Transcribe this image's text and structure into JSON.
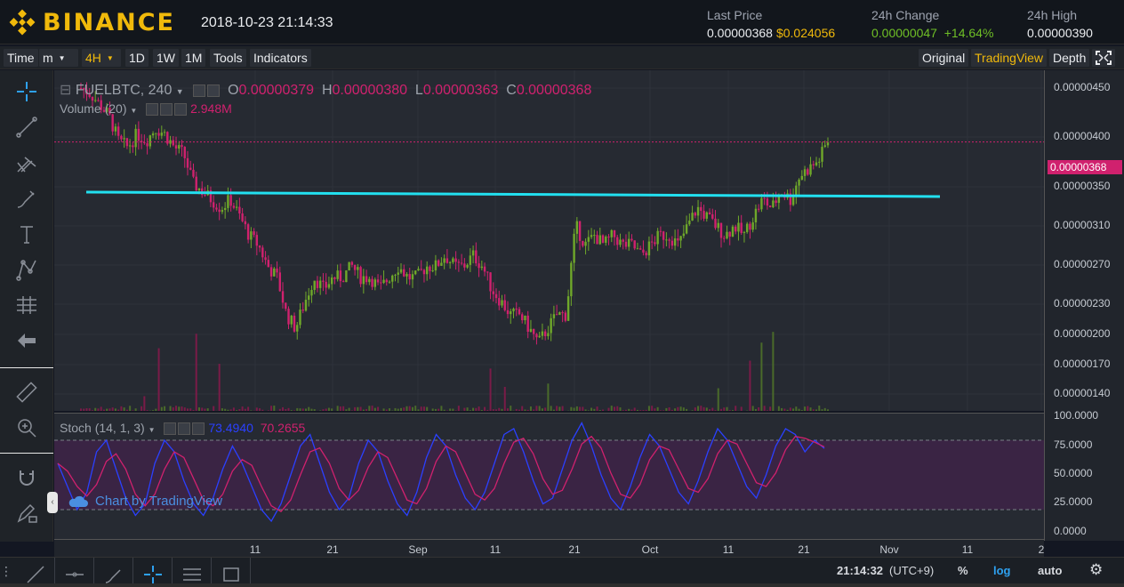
{
  "header": {
    "brand": "BINANCE",
    "datetime": "2018-10-23 21:14:33",
    "last_price_label": "Last Price",
    "last_price_btc": "0.00000368",
    "last_price_usd": "$0.024056",
    "change_label": "24h Change",
    "change_value": "0.00000047",
    "change_pct": "+14.64%",
    "high_label": "24h High",
    "high_value": "0.00000390"
  },
  "toolbar": {
    "time": "Time",
    "minute": "m",
    "interval": "4H",
    "d1": "1D",
    "w1": "1W",
    "m1": "1M",
    "tools": "Tools",
    "indicators": "Indicators",
    "original": "Original",
    "tradingview": "TradingView",
    "depth": "Depth"
  },
  "legend": {
    "symbol": "FUELBTC, 240",
    "o_label": "O",
    "o_value": "0.00000379",
    "h_label": "H",
    "h_value": "0.00000380",
    "l_label": "L",
    "l_value": "0.00000363",
    "c_label": "C",
    "c_value": "0.00000368",
    "volume": "Volume (20)",
    "volume_value": "2.948M",
    "stoch": "Stoch (14, 1, 3)",
    "stoch_k": "73.4940",
    "stoch_d": "70.2655",
    "watermark": "Chart by TradingView"
  },
  "price_axis": {
    "labels": [
      "0.00000450",
      "0.00000400",
      "0.00000350",
      "0.00000310",
      "0.00000270",
      "0.00000230",
      "0.00000200",
      "0.00000170",
      "0.00000140"
    ],
    "current": "0.00000368"
  },
  "stoch_axis": {
    "labels": [
      "100.0000",
      "75.0000",
      "50.0000",
      "25.0000",
      "0.0000"
    ]
  },
  "time_axis": {
    "labels": [
      "11",
      "21",
      "Sep",
      "11",
      "21",
      "Oct",
      "11",
      "21",
      "Nov",
      "11",
      "2"
    ]
  },
  "bottom": {
    "clock": "21:14:32",
    "tz": "(UTC+9)",
    "percent": "%",
    "log": "log",
    "auto": "auto"
  },
  "colors": {
    "accent": "#f0b90b",
    "up": "#6fa82a",
    "down": "#d0216e",
    "support_line": "#22e0f0",
    "stoch_k": "#2b40ff",
    "stoch_d": "#d0216e"
  },
  "chart_data": {
    "type": "candlestick",
    "ylim": [
      1.3e-06,
      4.6e-06
    ],
    "y_scale": "log",
    "close_series": [
      4.6e-06,
      4.5e-06,
      4.3e-06,
      4.1e-06,
      3.7e-06,
      3.6e-06,
      3.8e-06,
      3.7e-06,
      3.9e-06,
      3.8e-06,
      3.6e-06,
      3.5e-06,
      3.1e-06,
      3e-06,
      2.9e-06,
      2.8e-06,
      2.9e-06,
      2.7e-06,
      2.5e-06,
      2.4e-06,
      2.2e-06,
      2.1e-06,
      1.8e-06,
      1.7e-06,
      1.9e-06,
      2.1e-06,
      2e-06,
      2.1e-06,
      2.1e-06,
      2.2e-06,
      2.1e-06,
      2.1e-06,
      2e-06,
      2.1e-06,
      2.2e-06,
      2.1e-06,
      2.1e-06,
      2.2e-06,
      2.2e-06,
      2.3e-06,
      2.2e-06,
      2.2e-06,
      2.3e-06,
      2.2e-06,
      2e-06,
      1.9e-06,
      1.8e-06,
      1.8e-06,
      1.7e-06,
      1.6e-06,
      1.7e-06,
      1.8e-06,
      1.8e-06,
      2.6e-06,
      2.4e-06,
      2.5e-06,
      2.4e-06,
      2.5e-06,
      2.4e-06,
      2.4e-06,
      2.3e-06,
      2.4e-06,
      2.5e-06,
      2.5e-06,
      2.4e-06,
      2.6e-06,
      2.8e-06,
      2.7e-06,
      2.6e-06,
      2.5e-06,
      2.6e-06,
      2.5e-06,
      2.7e-06,
      2.9e-06,
      2.8e-06,
      3e-06,
      2.9e-06,
      3.2e-06,
      3.3e-06,
      3.4e-06,
      3.7e-06
    ],
    "support_level": 3.35e-06,
    "stoch_k_series": [
      60,
      40,
      20,
      35,
      70,
      80,
      55,
      30,
      15,
      25,
      60,
      80,
      70,
      45,
      25,
      15,
      30,
      55,
      75,
      60,
      40,
      20,
      10,
      25,
      50,
      75,
      85,
      60,
      35,
      20,
      30,
      60,
      80,
      70,
      45,
      25,
      15,
      35,
      65,
      85,
      75,
      50,
      30,
      20,
      35,
      60,
      85,
      90,
      70,
      45,
      25,
      30,
      55,
      80,
      95,
      75,
      50,
      30,
      20,
      40,
      65,
      85,
      75,
      55,
      35,
      25,
      45,
      70,
      90,
      80,
      60,
      40,
      30,
      50,
      75,
      90,
      85,
      70,
      80,
      73
    ],
    "stoch_lines": [
      80,
      20
    ]
  }
}
